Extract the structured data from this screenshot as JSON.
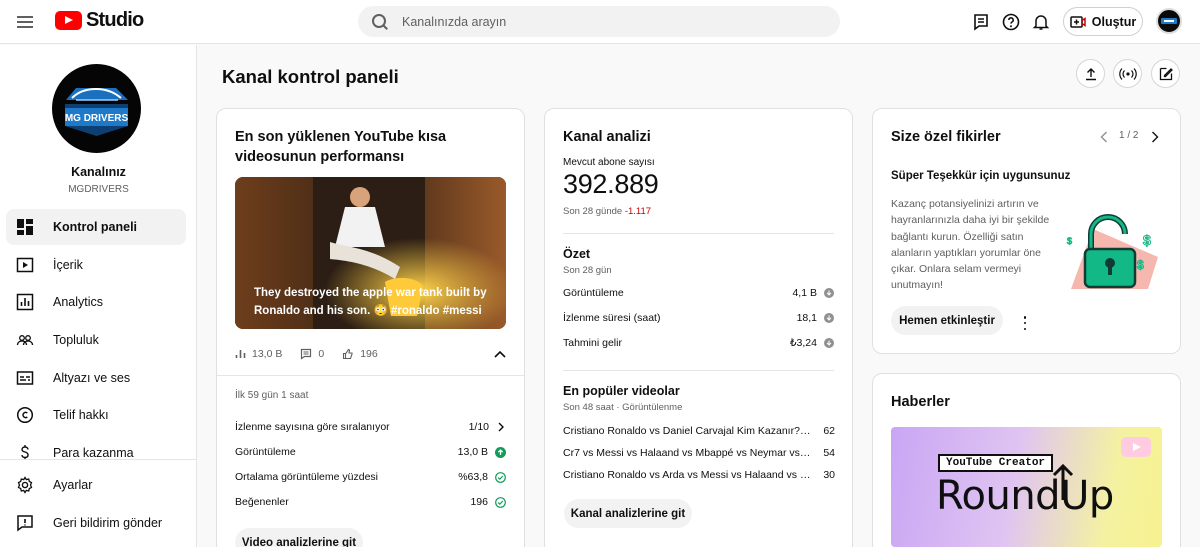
{
  "app": {
    "logo_text": "Studio",
    "brand_color": "#ff0000"
  },
  "header": {
    "search_placeholder": "Kanalınızda arayın",
    "create_label": "Oluştur"
  },
  "sidebar": {
    "channel_logo_text": "MG DRIVERS",
    "channel_title": "Kanalınız",
    "channel_handle": "MGDRIVERS",
    "items": [
      {
        "label": "Kontrol paneli",
        "icon": "dashboard-icon",
        "active": true
      },
      {
        "label": "İçerik",
        "icon": "content-icon"
      },
      {
        "label": "Analytics",
        "icon": "analytics-icon"
      },
      {
        "label": "Topluluk",
        "icon": "community-icon"
      },
      {
        "label": "Altyazı ve ses",
        "icon": "subtitles-icon"
      },
      {
        "label": "Telif hakkı",
        "icon": "copyright-icon"
      },
      {
        "label": "Para kazanma",
        "icon": "monetization-icon"
      },
      {
        "label": "Ayarlar",
        "icon": "gear-icon"
      },
      {
        "label": "Geri bildirim gönder",
        "icon": "feedback-icon"
      }
    ]
  },
  "main": {
    "title": "Kanal kontrol paneli"
  },
  "shorts_card": {
    "title": "En son yüklenen YouTube kısa videosunun performansı",
    "thumb_caption": "They destroyed the apple war tank built by Ronaldo and his son. 😳 #ronaldo #messi",
    "views": "13,0 B",
    "comments": "0",
    "likes": "196",
    "period": "İlk 59 gün 1 saat",
    "metrics": [
      {
        "label": "İzlenme sayısına göre sıralanıyor",
        "value": "1/10",
        "status": "chevron"
      },
      {
        "label": "Görüntüleme",
        "value": "13,0 B",
        "status": "up"
      },
      {
        "label": "Ortalama görüntüleme yüzdesi",
        "value": "%63,8",
        "status": "check"
      },
      {
        "label": "Beğenenler",
        "value": "196",
        "status": "check"
      }
    ],
    "button_label": "Video analizlerine git"
  },
  "analytics_card": {
    "title": "Kanal analizi",
    "subs_label": "Mevcut abone sayısı",
    "subs_count": "392.889",
    "subs_change_prefix": "Son 28 günde",
    "subs_change": "-1.117",
    "summary_title": "Özet",
    "summary_period": "Son 28 gün",
    "summary": [
      {
        "label": "Görüntüleme",
        "value": "4,1 B"
      },
      {
        "label": "İzlenme süresi (saat)",
        "value": "18,1"
      },
      {
        "label": "Tahmini gelir",
        "value": "₺3,24"
      }
    ],
    "top_title": "En popüler videolar",
    "top_period": "Son 48 saat · Görüntülenme",
    "top_videos": [
      {
        "title": "Cristiano Ronaldo vs Daniel Carvajal Kim Kazanır? #be...",
        "views": "62"
      },
      {
        "title": "Cr7 vs Messi vs Halaand vs Mbappé vs Neymar vs Ro...",
        "views": "54"
      },
      {
        "title": "Cristiano Ronaldo vs Arda vs Messi vs Halaand vs Mb...",
        "views": "30"
      }
    ],
    "button_label": "Kanal analizlerine git"
  },
  "ideas_card": {
    "title": "Size özel fikirler",
    "pager": "1 / 2",
    "headline": "Süper Teşekkür için uygunsunuz",
    "body": "Kazanç potansiyelinizi artırın ve hayranlarınızla daha iyi bir şekilde bağlantı kurun. Özelliği satın alanların yaptıkları yorumlar öne çıkar. Onlara selam vermeyi unutmayın!",
    "button_label": "Hemen etkinleştir"
  },
  "news_card": {
    "title": "Haberler",
    "badge": "YouTube Creator",
    "big_text": "RoundUp"
  }
}
